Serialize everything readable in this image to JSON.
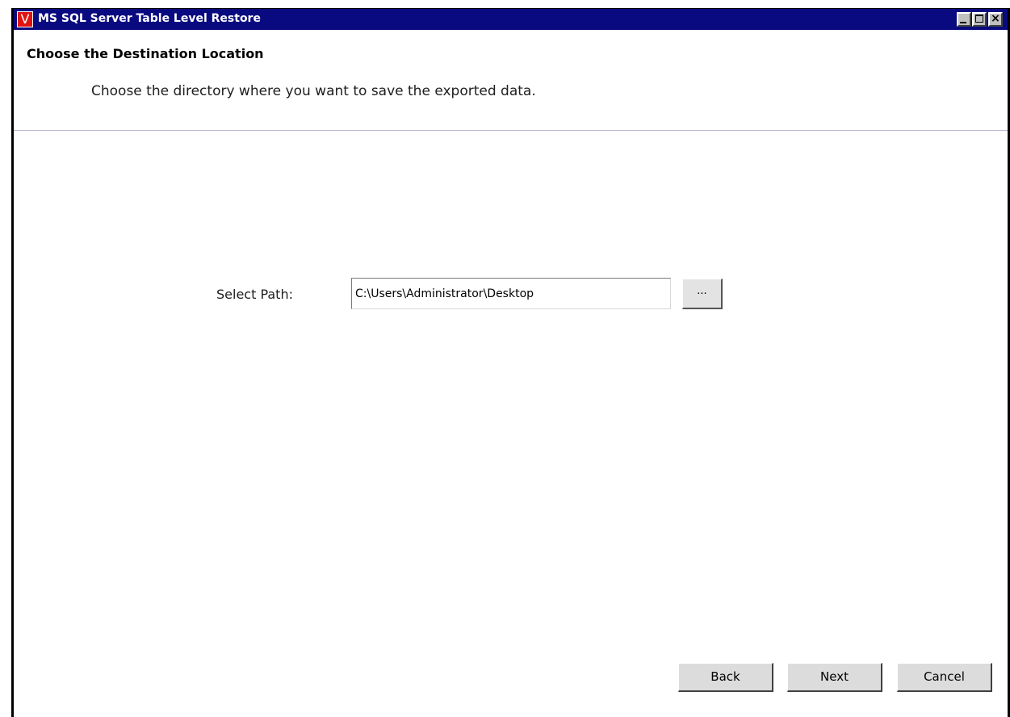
{
  "window": {
    "title": "MS SQL Server Table Level Restore",
    "app_icon_glyph": "V",
    "title_bar_color": "#0a0a80",
    "icon_color": "#e01212"
  },
  "header": {
    "heading": "Choose the Destination Location",
    "subheading": "Choose the directory where you want to save the exported data."
  },
  "form": {
    "path_label": "Select Path:",
    "path_value": "C:\\Users\\Administrator\\Desktop",
    "browse_label": "..."
  },
  "footer": {
    "back_label": "Back",
    "next_label": "Next",
    "cancel_label": "Cancel"
  },
  "icons": {
    "app": "app-logo-icon",
    "minimize": "minimize-icon",
    "maximize": "maximize-icon",
    "close": "close-icon"
  }
}
